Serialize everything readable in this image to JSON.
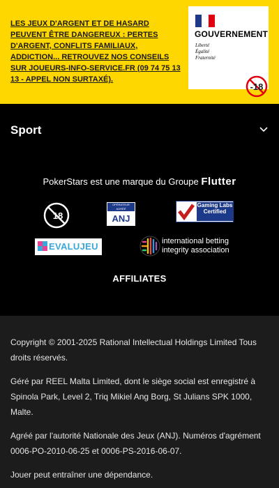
{
  "warning": {
    "text": "LES JEUX D'ARGENT ET DE HASARD PEUVENT ÊTRE DANGEREUX : PERTES D'ARGENT, CONFLITS FAMILIAUX, ADDICTION... RETROUVEZ NOS CONSEILS SUR JOUEURS-INFO-SERVICE.FR (09 74 75 13 13 - APPEL NON SURTAXÉ).",
    "background": "#ffd700"
  },
  "gov_logo": {
    "name": "GOUVERNEMENT",
    "motto": [
      "Liberté",
      "Égalité",
      "Fraternité"
    ]
  },
  "age_badge": {
    "label": "-18",
    "icon": "no-minors-icon"
  },
  "sport": {
    "label": "Sport",
    "icon": "chevron-down-icon"
  },
  "brand": {
    "text": "PokerStars est une marque du Groupe",
    "group": "Flutter"
  },
  "partners": {
    "anj": {
      "top": "OPÉRATEUR AGRÉÉ",
      "label": "ANJ"
    },
    "gli": {
      "label": "Gaming Labs Certified"
    },
    "evalujeu": {
      "label": "EVALUJEU"
    },
    "ibia": {
      "label": "international betting integrity association"
    }
  },
  "affiliates": {
    "label": "AFFILIATES"
  },
  "footer": {
    "copyright": "Copyright © 2001-2025 Rational Intellectual Holdings Limited Tous droits réservés.",
    "managed": "Géré par REEL Malta Limited, dont le siège social est enregistré à Spinola Park, Level 2, Triq Mikiel Ang Borg, St Julians SPK 1000, Malte.",
    "licence": "Agréé par l'autorité Nationale des Jeux (ANJ). Numéros d'agrément 0006-PO-2010-06-25 et 0006-PS-2016-06-07.",
    "dependency": "Jouer peut entraîner une dépendance.",
    "background": "#1c1c1c"
  }
}
